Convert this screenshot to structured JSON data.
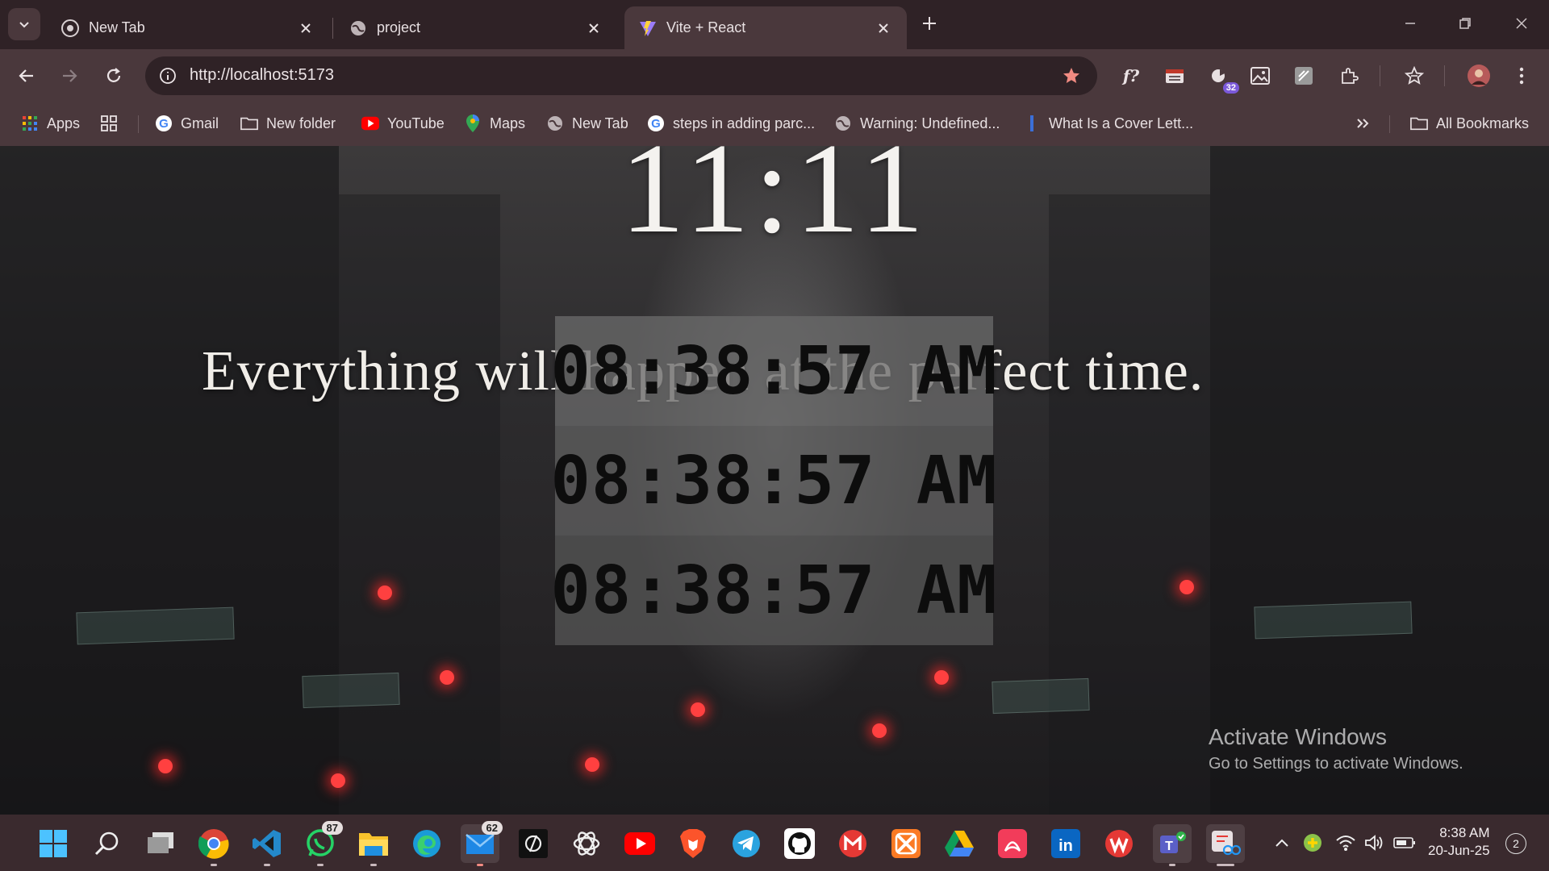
{
  "browser": {
    "tabs": [
      {
        "label": "New Tab",
        "icon": "chrome-icon",
        "active": false
      },
      {
        "label": "project",
        "icon": "globe-icon",
        "active": false
      },
      {
        "label": "Vite + React",
        "icon": "vite-icon",
        "active": true
      }
    ],
    "url": "http://localhost:5173",
    "extension_badge": "32",
    "bookmarks": [
      {
        "label": "Apps",
        "icon": "apps-grid-icon"
      },
      {
        "label": "Gmail",
        "icon": "google-icon"
      },
      {
        "label": "New folder",
        "icon": "folder-icon"
      },
      {
        "label": "YouTube",
        "icon": "youtube-icon"
      },
      {
        "label": "Maps",
        "icon": "maps-pin-icon"
      },
      {
        "label": "New Tab",
        "icon": "globe-icon"
      },
      {
        "label": "steps in adding parc...",
        "icon": "google-icon"
      },
      {
        "label": "Warning: Undefined...",
        "icon": "globe-icon"
      },
      {
        "label": "What Is a Cover Lett...",
        "icon": "bookmark-icon"
      }
    ],
    "all_bookmarks": "All Bookmarks"
  },
  "page": {
    "big_clock": "11:11",
    "quote": "Everything will happen at the perfect time.",
    "clocks": [
      "08:38:57 AM",
      "08:38:57 AM",
      "08:38:57 AM"
    ]
  },
  "watermark": {
    "line1": "Activate Windows",
    "line2": "Go to Settings to activate Windows."
  },
  "taskbar": {
    "whatsapp_badge": "87",
    "mail_badge": "62",
    "time": "8:38 AM",
    "date": "20-Jun-25",
    "notifications": "2"
  },
  "colors": {
    "chrome_bg": "#4a383c",
    "tabstrip_bg": "#2f2226",
    "accent_star": "#f28b82"
  }
}
